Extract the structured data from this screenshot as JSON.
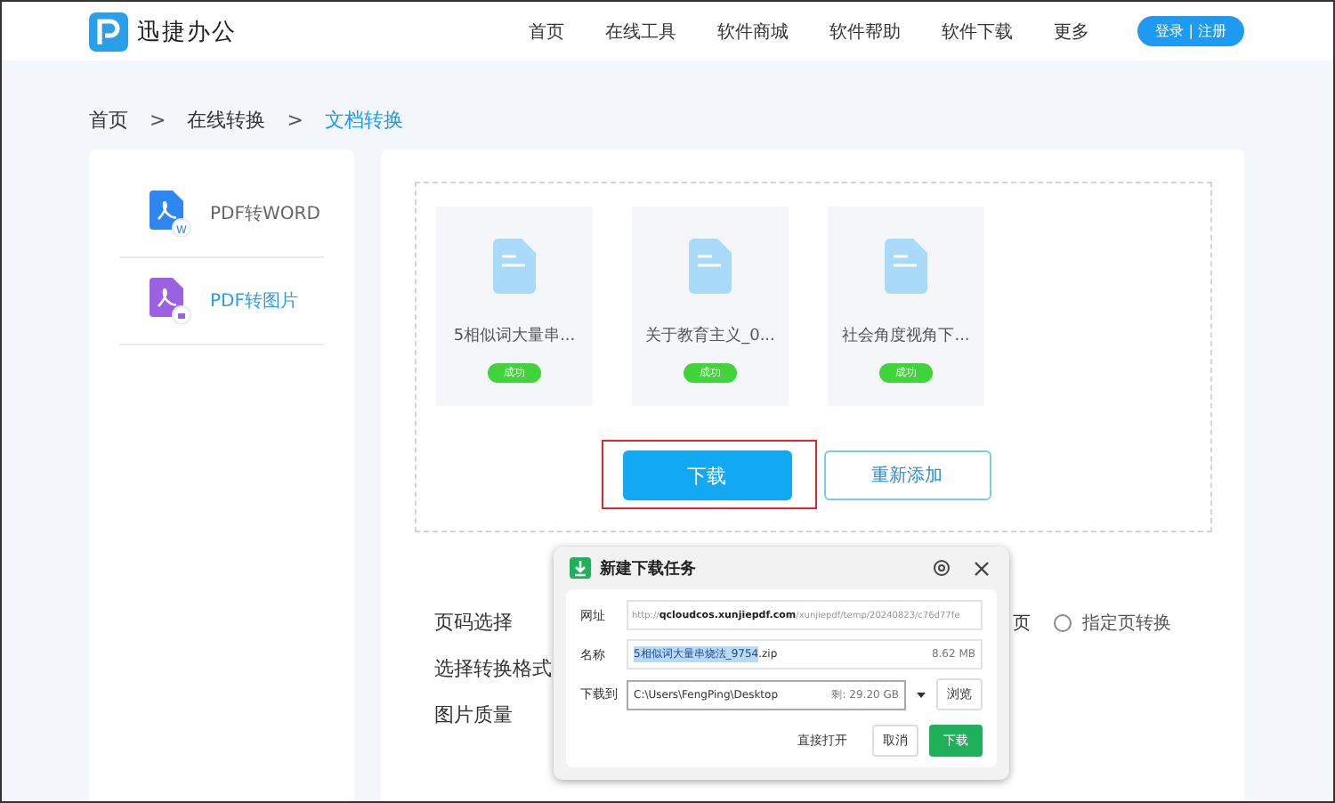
{
  "header": {
    "logo_text": "迅捷办公",
    "nav": [
      {
        "label": "首页"
      },
      {
        "label": "在线工具"
      },
      {
        "label": "软件商城"
      },
      {
        "label": "软件帮助"
      },
      {
        "label": "软件下载"
      },
      {
        "label": "更多"
      }
    ],
    "login_button": "登录 | 注册"
  },
  "breadcrumb": [
    {
      "label": "首页",
      "current": false
    },
    {
      "label": "在线转换",
      "current": false
    },
    {
      "label": "文档转换",
      "current": true
    }
  ],
  "breadcrumb_separator": ">",
  "sidebar": {
    "items": [
      {
        "label": "PDF转WORD",
        "kind": "word",
        "badge": "W",
        "selected": false
      },
      {
        "label": "PDF转图片",
        "kind": "image",
        "selected": true
      }
    ]
  },
  "files": [
    {
      "name": "5相似词大量串...",
      "status": "成功"
    },
    {
      "name": "关于教育主义_0...",
      "status": "成功"
    },
    {
      "name": "社会角度视角下...",
      "status": "成功"
    }
  ],
  "actions": {
    "download": "下载",
    "download_highlighted": true,
    "re_add": "重新添加"
  },
  "form": {
    "rows": [
      {
        "label": "页码选择",
        "partial_option": "页",
        "radio": {
          "label": "指定页转换",
          "selected": false
        }
      },
      {
        "label": "选择转换格式"
      },
      {
        "label": "图片质量"
      }
    ]
  },
  "dialog": {
    "title": "新建下载任务",
    "url_label": "网址",
    "url": "http://**qcloudcos.xunjiepdf.com**/xunjiepdf/temp/20240823/c76d77fe",
    "name_label": "名称",
    "name_selected": "5相似词大量串烧法_9754",
    "name_rest": ".zip",
    "size": "8.62 MB",
    "save_label": "下载到",
    "path": "C:\\Users\\FengPing\\Desktop",
    "free": "剩: 29.20 GB",
    "browse": "浏览",
    "open_button": "直接打开",
    "cancel_button": "取消",
    "download_button": "下载"
  }
}
